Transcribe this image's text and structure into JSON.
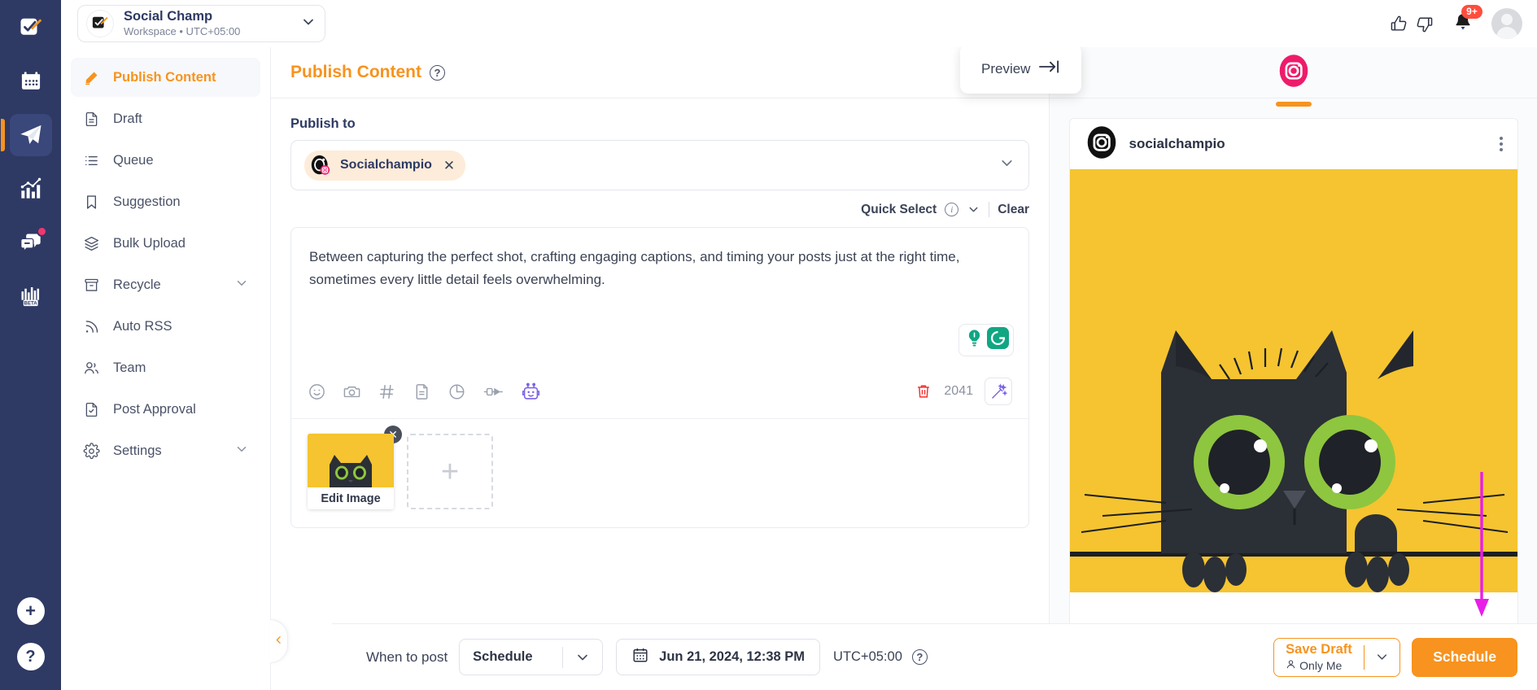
{
  "workspace": {
    "name": "Social Champ",
    "subtitle": "Workspace • UTC+05:00",
    "logo_icon": "checkbox-pencil-logo-icon",
    "caret_icon": "chevron-down-icon"
  },
  "topbar": {
    "thumbs_up_icon": "thumbs-up-icon",
    "thumbs_down_icon": "thumbs-down-icon",
    "notification_icon": "bell-icon",
    "notification_badge": "9+",
    "avatar_icon": "user-avatar-icon"
  },
  "rail": {
    "items": [
      {
        "name": "compose",
        "icon": "checkbox-pencil-icon",
        "active": false,
        "badge": false
      },
      {
        "name": "calendar",
        "icon": "calendar-icon",
        "active": false,
        "badge": false
      },
      {
        "name": "publish",
        "icon": "paper-plane-icon",
        "active": true,
        "badge": false
      },
      {
        "name": "analytics",
        "icon": "bar-chart-trend-icon",
        "active": false,
        "badge": false
      },
      {
        "name": "inbox",
        "icon": "chat-bubbles-icon",
        "active": false,
        "badge": true
      },
      {
        "name": "reports-beta",
        "icon": "beta-chart-icon",
        "active": false,
        "badge": false
      }
    ],
    "add_label": "+",
    "help_label": "?"
  },
  "sidebar": {
    "items": [
      {
        "label": "Publish Content",
        "icon": "pencil-icon",
        "active": true,
        "caret": false
      },
      {
        "label": "Draft",
        "icon": "document-icon",
        "active": false,
        "caret": false
      },
      {
        "label": "Queue",
        "icon": "list-icon",
        "active": false,
        "caret": false
      },
      {
        "label": "Suggestion",
        "icon": "bookmark-icon",
        "active": false,
        "caret": false
      },
      {
        "label": "Bulk Upload",
        "icon": "layers-icon",
        "active": false,
        "caret": false
      },
      {
        "label": "Recycle",
        "icon": "archive-box-icon",
        "active": false,
        "caret": true
      },
      {
        "label": "Auto RSS",
        "icon": "rss-icon",
        "active": false,
        "caret": false
      },
      {
        "label": "Team",
        "icon": "users-icon",
        "active": false,
        "caret": false
      },
      {
        "label": "Post Approval",
        "icon": "document-check-icon",
        "active": false,
        "caret": false
      },
      {
        "label": "Settings",
        "icon": "gear-icon",
        "active": false,
        "caret": true
      }
    ],
    "collapse_icon": "chevron-left-icon"
  },
  "composer": {
    "title": "Publish Content",
    "title_help_icon": "question-mark-icon",
    "publish_to_label": "Publish to",
    "account": {
      "name": "Socialchampio",
      "platform": "instagram",
      "remove_icon": "close-x-icon"
    },
    "dropdown_caret_icon": "chevron-down-icon",
    "quick_select_label": "Quick Select",
    "quick_select_info_icon": "info-icon",
    "quick_select_caret_icon": "chevron-down-icon",
    "clear_label": "Clear",
    "editor_text": "Between capturing the perfect shot, crafting engaging captions, and timing your posts just at the right time, sometimes every little detail feels overwhelming.",
    "grammar_icons": [
      "lightbulb-icon",
      "grammarly-icon"
    ],
    "toolbar_icons": [
      "emoji-icon",
      "camera-icon",
      "hashtag-icon",
      "saved-reply-icon",
      "poll-icon",
      "plug-icon",
      "ai-robot-icon"
    ],
    "delete_icon": "trash-icon",
    "char_count": "2041",
    "magic_icon": "magic-wand-icon",
    "media": {
      "edit_image_label": "Edit Image",
      "remove_icon": "close-x-icon",
      "add_icon": "plus-icon"
    }
  },
  "preview": {
    "tooltip_label": "Preview",
    "tooltip_icon": "arrow-right-to-bar-icon",
    "platform_tab_icon": "instagram-icon",
    "post": {
      "username": "socialchampio",
      "avatar_icon": "instagram-icon",
      "more_icon": "three-dots-vertical-icon"
    },
    "annotation_arrow_icon": "magenta-down-arrow-icon"
  },
  "bottombar": {
    "when_to_post_label": "When to post",
    "schedule_mode": "Schedule",
    "schedule_caret_icon": "chevron-down-icon",
    "calendar_icon": "calendar-icon",
    "datetime": "Jun 21, 2024, 12:38 PM",
    "timezone": "UTC+05:00",
    "timezone_help_icon": "question-mark-icon",
    "save_draft_label": "Save Draft",
    "save_draft_sub": "Only Me",
    "save_draft_person_icon": "person-icon",
    "save_draft_caret_icon": "chevron-down-icon",
    "primary_button_label": "Schedule"
  },
  "colors": {
    "brand_orange": "#f7931e",
    "navy": "#2e3a64",
    "instagram_pink": "#ee1b6b",
    "image_yellow": "#f5c430",
    "annotation_magenta": "#e81ee8"
  }
}
